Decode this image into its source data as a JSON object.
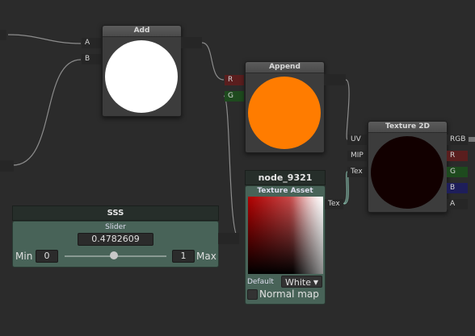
{
  "nodes": {
    "add": {
      "title": "Add",
      "inputs": [
        "A",
        "B"
      ],
      "preview_color": "#ffffff"
    },
    "append": {
      "title": "Append",
      "inputs": [
        "R",
        "G"
      ],
      "preview_color": "#ff7c00"
    },
    "texture2d": {
      "title": "Texture 2D",
      "inputs": [
        "UV",
        "MIP",
        "Tex"
      ],
      "outputs": [
        "RGB",
        "R",
        "G",
        "B",
        "A"
      ],
      "preview_color": "#120000"
    },
    "sss": {
      "title": "SSS",
      "subtitle": "Slider",
      "value": "0.4782609",
      "min_label": "Min",
      "min_value": "0",
      "max_value": "1",
      "max_label": "Max",
      "slider_fraction": 0.478
    },
    "node_9321": {
      "title": "node_9321",
      "subtitle": "Texture Asset",
      "output_label": "Tex",
      "default_label": "Default",
      "default_value": "White",
      "normal_map_label": "Normal map",
      "normal_map_checked": false
    }
  },
  "colors": {
    "port_r": "#5a1e1e",
    "port_g": "#1e4a1e",
    "port_b": "#1e1e5a",
    "node_accent": "#486358"
  }
}
